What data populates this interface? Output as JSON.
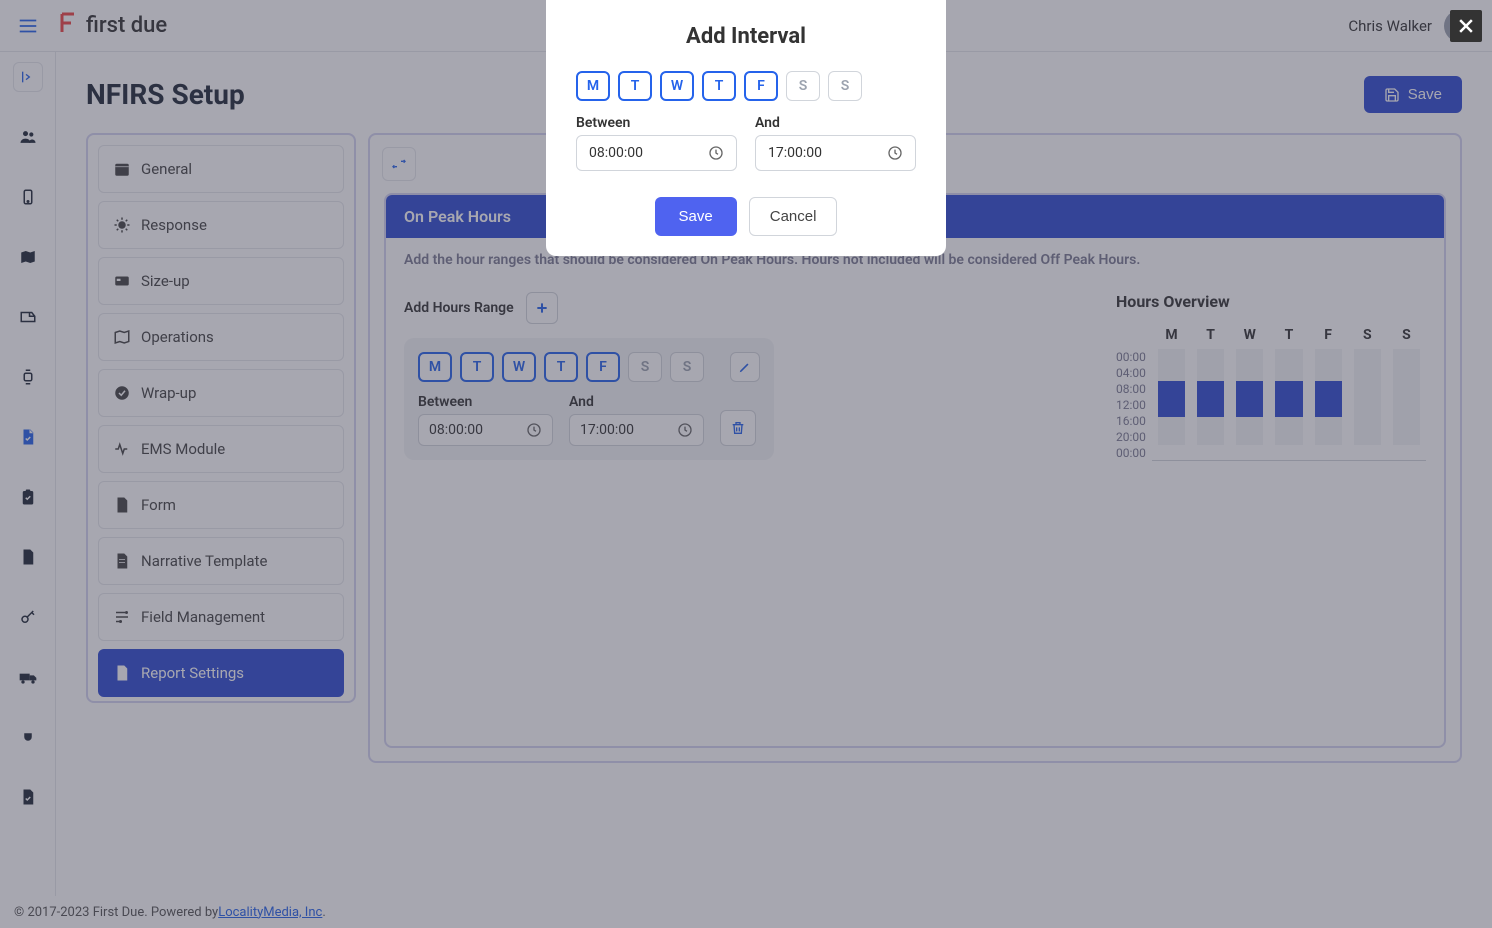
{
  "header": {
    "brand": "first due",
    "user_name": "Chris Walker"
  },
  "page": {
    "title": "NFIRS Setup",
    "save_label": "Save"
  },
  "section_nav": [
    {
      "label": "General",
      "active": false
    },
    {
      "label": "Response",
      "active": false
    },
    {
      "label": "Size-up",
      "active": false
    },
    {
      "label": "Operations",
      "active": false
    },
    {
      "label": "Wrap-up",
      "active": false
    },
    {
      "label": "EMS Module",
      "active": false
    },
    {
      "label": "Form",
      "active": false
    },
    {
      "label": "Narrative Template",
      "active": false
    },
    {
      "label": "Field Management",
      "active": false
    },
    {
      "label": "Report Settings",
      "active": true
    }
  ],
  "panel": {
    "header": "On Peak Hours",
    "hint": "Add the hour ranges that should be considered On Peak Hours. Hours not included will be considered Off Peak Hours.",
    "add_label": "Add Hours Range",
    "range_card": {
      "days": [
        {
          "label": "M",
          "on": true
        },
        {
          "label": "T",
          "on": true
        },
        {
          "label": "W",
          "on": true
        },
        {
          "label": "T",
          "on": true
        },
        {
          "label": "F",
          "on": true
        },
        {
          "label": "S",
          "on": false
        },
        {
          "label": "S",
          "on": false
        }
      ],
      "between_label": "Between",
      "and_label": "And",
      "between_value": "08:00:00",
      "and_value": "17:00:00"
    },
    "overview": {
      "title": "Hours Overview"
    }
  },
  "modal": {
    "title": "Add Interval",
    "days": [
      {
        "label": "M",
        "on": true
      },
      {
        "label": "T",
        "on": true
      },
      {
        "label": "W",
        "on": true
      },
      {
        "label": "T",
        "on": true
      },
      {
        "label": "F",
        "on": true
      },
      {
        "label": "S",
        "on": false
      },
      {
        "label": "S",
        "on": false
      }
    ],
    "between_label": "Between",
    "and_label": "And",
    "between_value": "08:00:00",
    "and_value": "17:00:00",
    "save_label": "Save",
    "cancel_label": "Cancel"
  },
  "footer": {
    "copyright": "© 2017-2023 First Due. Powered by ",
    "link_text": "LocalityMedia, Inc",
    "period": "."
  },
  "chart_data": {
    "type": "heatmap",
    "title": "Hours Overview",
    "xlabel": "",
    "ylabel": "",
    "categories": [
      "M",
      "T",
      "W",
      "T",
      "F",
      "S",
      "S"
    ],
    "y_ticks": [
      "00:00",
      "04:00",
      "08:00",
      "12:00",
      "16:00",
      "20:00",
      "00:00"
    ],
    "y_range_hours": [
      0,
      24
    ],
    "series": [
      {
        "name": "On Peak",
        "intervals": [
          {
            "day": "M",
            "start": 8,
            "end": 17
          },
          {
            "day": "T",
            "start": 8,
            "end": 17
          },
          {
            "day": "W",
            "start": 8,
            "end": 17
          },
          {
            "day": "T",
            "start": 8,
            "end": 17
          },
          {
            "day": "F",
            "start": 8,
            "end": 17
          }
        ]
      }
    ]
  }
}
